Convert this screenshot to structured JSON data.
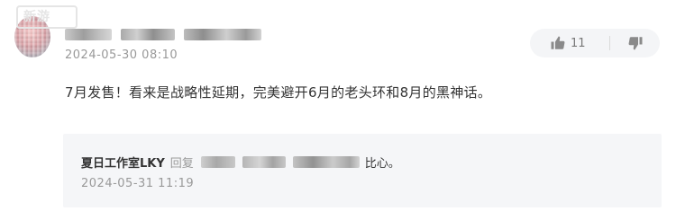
{
  "comment": {
    "watermark": "新游",
    "timestamp": "2024-05-30 08:10",
    "text": "7月发售！看来是战略性延期，完美避开6月的老头环和8月的黑神话。",
    "likes": "11",
    "icons": {
      "like": "thumbs-up-icon",
      "dislike": "thumbs-down-icon"
    }
  },
  "reply": {
    "author": "夏日工作室LKY",
    "reply_word": "回复",
    "text_tail": "比心。",
    "timestamp": "2024-05-31 11:19"
  }
}
